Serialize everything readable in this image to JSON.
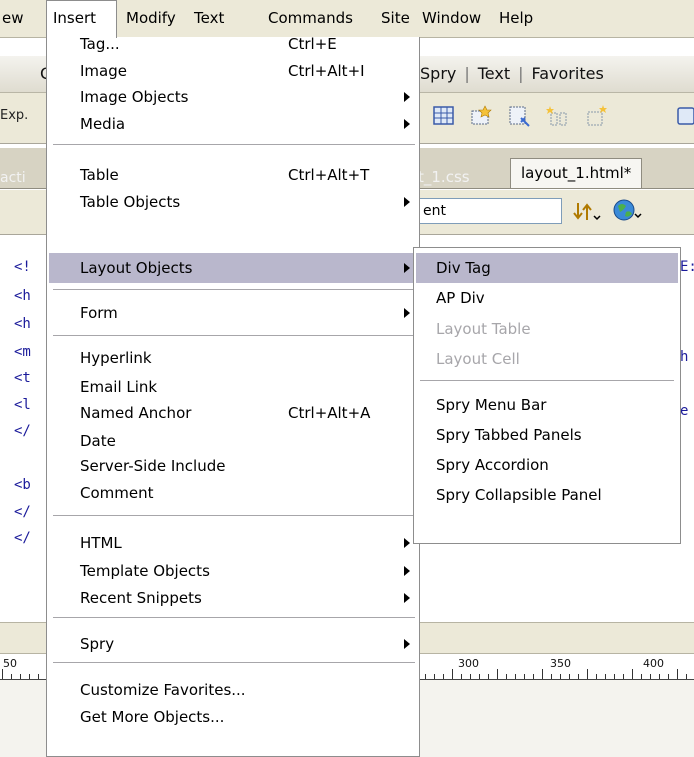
{
  "menubar": {
    "items": [
      {
        "label": "ew"
      },
      {
        "label": "Insert"
      },
      {
        "label": "Modify"
      },
      {
        "label": "Text"
      },
      {
        "label": "Commands"
      },
      {
        "label": "Site"
      },
      {
        "label": "Window"
      },
      {
        "label": "Help"
      }
    ]
  },
  "background": {
    "insert_bar_tabs": [
      "C",
      "Spry",
      "Text",
      "Favorites"
    ],
    "expand_label": "Exp.",
    "left_tab_label": "acti",
    "doc_tabs": [
      "t_1.css",
      "layout_1.html*"
    ],
    "title_field_value": "ent",
    "code_lines": [
      "<!",
      "<h",
      "<h",
      "<m",
      "<t",
      "<l",
      "</",
      "<b",
      "</",
      "</"
    ],
    "code_right": [
      "E:",
      "h",
      "e"
    ],
    "ruler_labels": [
      "50",
      "300",
      "350",
      "400"
    ]
  },
  "insert_menu": {
    "items": [
      {
        "label": "Tag...",
        "shortcut": "Ctrl+E"
      },
      {
        "label": "Image",
        "shortcut": "Ctrl+Alt+I"
      },
      {
        "label": "Image Objects",
        "submenu": true
      },
      {
        "label": "Media",
        "submenu": true
      },
      {
        "label": "Table",
        "shortcut": "Ctrl+Alt+T"
      },
      {
        "label": "Table Objects",
        "submenu": true
      },
      {
        "label": "Layout Objects",
        "submenu": true,
        "highlighted": true
      },
      {
        "label": "Form",
        "submenu": true
      },
      {
        "label": "Hyperlink"
      },
      {
        "label": "Email Link"
      },
      {
        "label": "Named Anchor",
        "shortcut": "Ctrl+Alt+A"
      },
      {
        "label": "Date"
      },
      {
        "label": "Server-Side Include"
      },
      {
        "label": "Comment"
      },
      {
        "label": "HTML",
        "submenu": true
      },
      {
        "label": "Template Objects",
        "submenu": true
      },
      {
        "label": "Recent Snippets",
        "submenu": true
      },
      {
        "label": "Spry",
        "submenu": true
      },
      {
        "label": "Customize Favorites..."
      },
      {
        "label": "Get More Objects..."
      }
    ]
  },
  "layout_objects_submenu": {
    "items": [
      {
        "label": "Div Tag",
        "highlighted": true
      },
      {
        "label": "AP Div"
      },
      {
        "label": "Layout Table",
        "disabled": true
      },
      {
        "label": "Layout Cell",
        "disabled": true
      },
      {
        "label": "Spry Menu Bar"
      },
      {
        "label": "Spry Tabbed Panels"
      },
      {
        "label": "Spry Accordion"
      },
      {
        "label": "Spry Collapsible Panel"
      }
    ]
  },
  "colors": {
    "menu_highlight": "#b9b7cc",
    "disabled_text": "#a7a6aa",
    "chrome": "#ece9d8",
    "code_text": "#1a1a9a"
  }
}
